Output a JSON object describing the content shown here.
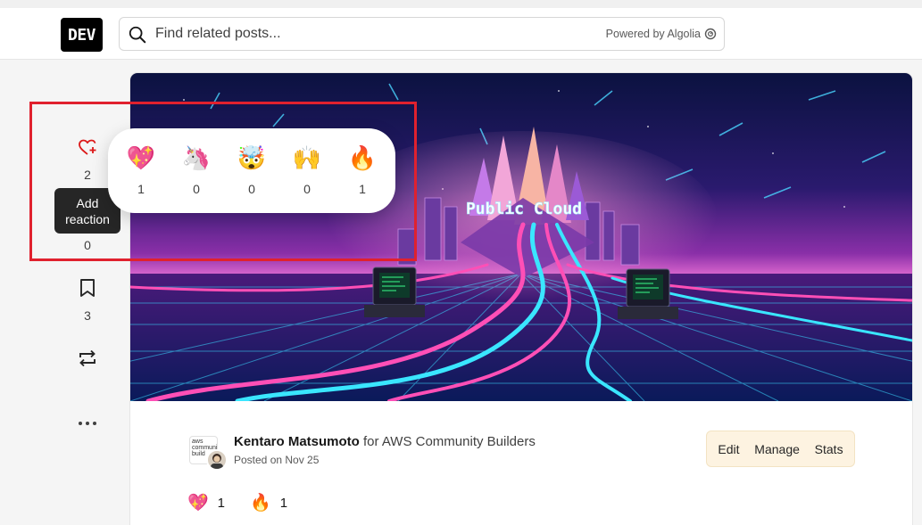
{
  "header": {
    "logo_text": "DEV",
    "search": {
      "placeholder": "Find related posts...",
      "powered_by": "Powered by Algolia"
    }
  },
  "actions": {
    "like_count": "2",
    "tooltip": "Add reaction",
    "unicorn_count": "0",
    "bookmark_count": "3"
  },
  "reaction_drawer": [
    {
      "emoji": "💖",
      "icon": "sparkle-heart-icon",
      "count": "1"
    },
    {
      "emoji": "🦄",
      "icon": "unicorn-icon",
      "count": "0"
    },
    {
      "emoji": "🤯",
      "icon": "exploding-head-icon",
      "count": "0"
    },
    {
      "emoji": "🙌",
      "icon": "raised-hands-icon",
      "count": "0"
    },
    {
      "emoji": "🔥",
      "icon": "fire-icon",
      "count": "1"
    }
  ],
  "cover": {
    "title": "Public Cloud"
  },
  "article": {
    "author": "Kentaro Matsumoto",
    "for_text": " for AWS Community Builders",
    "posted": "Posted on Nov 25",
    "org_badge": "aws community build"
  },
  "owner_actions": {
    "edit": "Edit",
    "manage": "Manage",
    "stats": "Stats"
  },
  "bottom_reactions": [
    {
      "emoji": "💖",
      "count": "1"
    },
    {
      "emoji": "🔥",
      "count": "1"
    }
  ],
  "colors": {
    "highlight": "#e0212e",
    "accent": "#3b49df",
    "like_red": "#dc1818"
  }
}
